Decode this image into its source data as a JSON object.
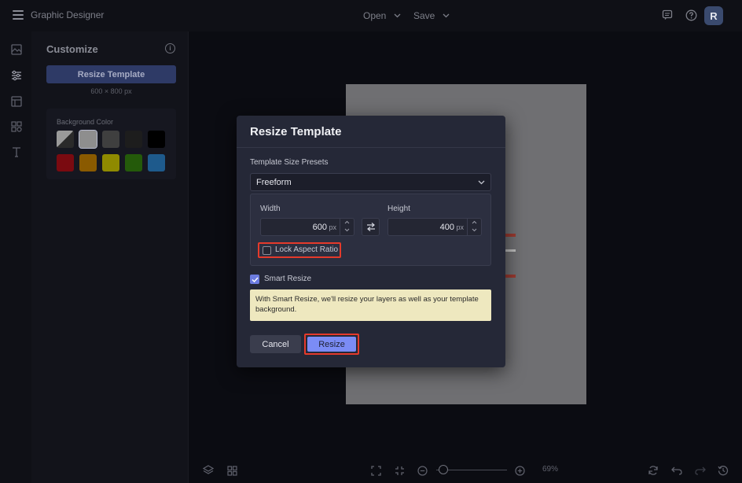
{
  "app": {
    "title": "Graphic Designer"
  },
  "topbar": {
    "open_label": "Open",
    "save_label": "Save",
    "user_initial": "R"
  },
  "icons": {
    "menu": "hamburger-icon",
    "comments": "comment-icon",
    "help": "help-icon",
    "rail": [
      "image-icon",
      "sliders-icon",
      "layout-icon",
      "elements-icon",
      "text-icon"
    ]
  },
  "panel": {
    "title": "Customize",
    "resize_button": "Resize Template",
    "size_text": "600 × 800 px",
    "background_label": "Background Color",
    "swatches": [
      "#6b6b6b",
      "#8e8e8e",
      "#3f3f3f",
      "#1d1d1d",
      "#000000",
      "#7a0a10",
      "#8a5a00",
      "#8f8a00",
      "#245a0a",
      "#1e5a8c"
    ]
  },
  "modal": {
    "title": "Resize Template",
    "presets_label": "Template Size Presets",
    "preset_value": "Freeform",
    "width_label": "Width",
    "width_value": "600",
    "height_label": "Height",
    "height_value": "400",
    "unit": "px",
    "lock_label": "Lock Aspect Ratio",
    "lock_checked": false,
    "smart_label": "Smart Resize",
    "smart_checked": true,
    "smart_note": "With Smart Resize, we'll resize your layers as well as your template background.",
    "cancel_label": "Cancel",
    "resize_label": "Resize"
  },
  "bottombar": {
    "zoom_level": "69%",
    "zoom_fraction": 0.1
  },
  "colors": {
    "accent": "#7b8cf5",
    "highlight": "#e53a2b",
    "note_bg": "#eee8bf"
  }
}
